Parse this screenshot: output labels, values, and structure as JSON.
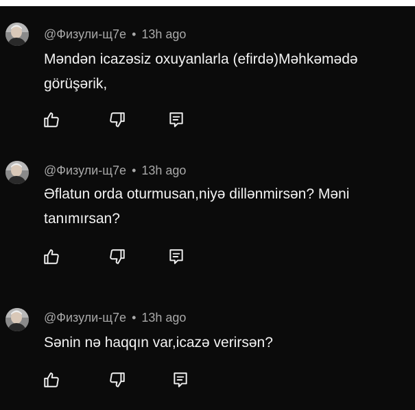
{
  "comments": [
    {
      "author": "@Физули-щ7е",
      "separator": "•",
      "time": "13h ago",
      "text_lines": [
        "Məndən icazəsiz oxuyanlarla (efirdə)Məhkəmədə",
        "görüşərik,"
      ]
    },
    {
      "author": "@Физули-щ7е",
      "separator": "•",
      "time": "13h ago",
      "text_lines": [
        "Əflatun orda oturmusan,niyə dillənmirsən? Məni",
        "tanımırsan?"
      ]
    },
    {
      "author": "@Физули-щ7е",
      "separator": "•",
      "time": "13h ago",
      "text_lines": [
        "Sənin nə haqqın var,icazə verirsən?"
      ]
    }
  ],
  "icons": {
    "like": "thumbs-up-icon",
    "dislike": "thumbs-down-icon",
    "reply": "reply-icon"
  },
  "colors": {
    "background": "#0b0b0b",
    "text": "#f3f3f3",
    "meta": "#a9a9a9",
    "icon": "#f1f1f1"
  }
}
